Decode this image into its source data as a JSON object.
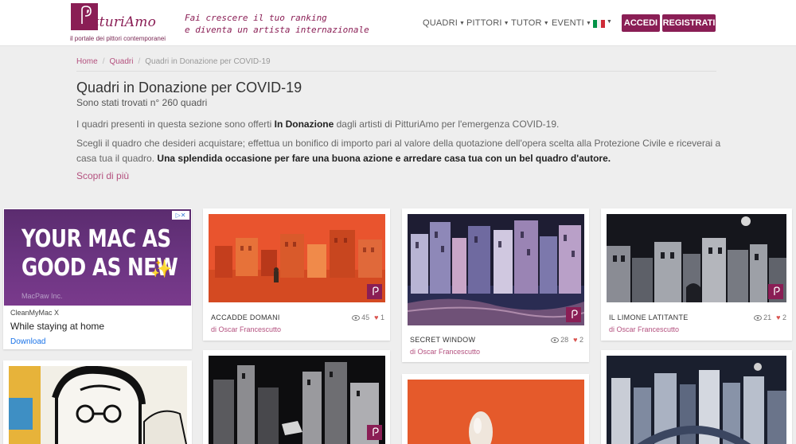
{
  "brand": {
    "logo_text": "itturiAmo",
    "subtitle": "il portale dei pittori contemporanei",
    "tagline_line1": "Fai crescere il tuo ranking",
    "tagline_line2": "e diventa un artista internazionale",
    "color": "#8a1e55"
  },
  "nav": {
    "items": [
      "QUADRI",
      "PITTORI",
      "TUTOR",
      "EVENTI"
    ],
    "language": "IT",
    "login": "ACCEDI",
    "register": "REGISTRATI"
  },
  "breadcrumb": [
    "Home",
    "Quadri",
    "Quadri in Donazione per COVID-19"
  ],
  "page": {
    "title": "Quadri in Donazione per COVID-19",
    "count_text": "Sono stati trovati n° 260 quadri",
    "p1_a": "I quadri presenti in questa sezione sono offerti ",
    "p1_b": "In Donazione",
    "p1_c": " dagli artisti di PitturiAmo per l'emergenza COVID-19.",
    "p2_a": "Scegli il quadro che desideri acquistare; effettua un bonifico di importo pari al valore della quotazione dell'opera scelta alla Protezione Civile e riceverai a casa tua il quadro. ",
    "p2_b": "Una splendida occasione per fare una buona azione e arredare casa tua con un bel quadro d'autore.",
    "more_link": "Scopri di più"
  },
  "ad": {
    "headline_1": "YOUR MAC AS",
    "headline_2": "GOOD AS NEW",
    "brand": "MacPaw Inc.",
    "app": "CleanMyMac X",
    "line": "While staying at home",
    "cta": "Download"
  },
  "cards": [
    {
      "title": "ACCADDE DOMANI",
      "author": "di Oscar Francescutto",
      "views": "45",
      "likes": "1"
    },
    {
      "title": "SECRET WINDOW",
      "author": "di Oscar Francescutto",
      "views": "28",
      "likes": "2"
    },
    {
      "title": "IL LIMONE LATITANTE",
      "author": "di Oscar Francescutto",
      "views": "21",
      "likes": "2"
    }
  ]
}
